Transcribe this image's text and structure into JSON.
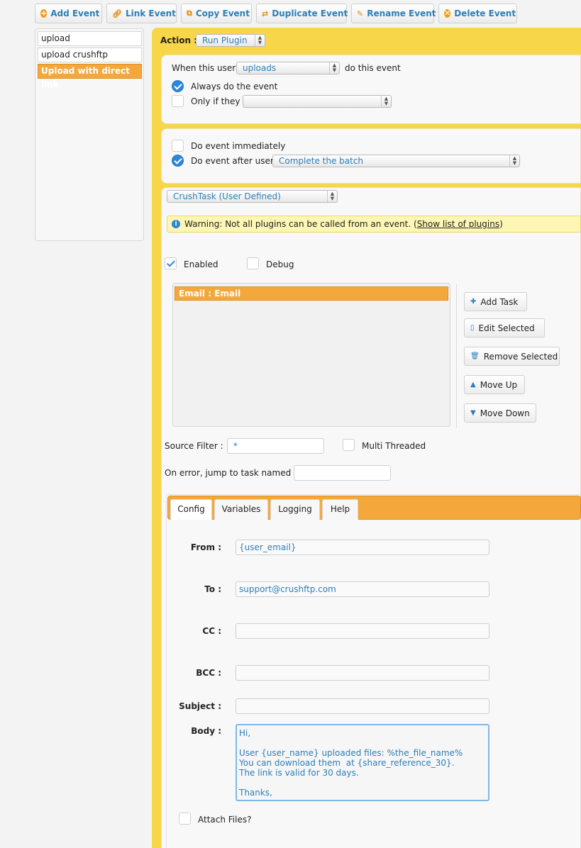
{
  "toolbar": {
    "add_event": "Add Event",
    "link_event": "Link Event",
    "copy_event": "Copy Event",
    "duplicate_event": "Duplicate Event",
    "rename_event": "Rename Event",
    "delete_event": "Delete Event"
  },
  "events": [
    {
      "label": "upload",
      "selected": false
    },
    {
      "label": "upload crushftp",
      "selected": false
    },
    {
      "label": "Upload with direct link",
      "selected": true
    }
  ],
  "action": {
    "label": "Action :",
    "value": "Run Plugin"
  },
  "trigger": {
    "when_label": "When this user",
    "user_select": "uploads",
    "do_label": "do this event",
    "always_label": "Always do the event",
    "always_checked": true,
    "only_if_label": "Only if they",
    "only_if_select": "",
    "only_if_checked": false
  },
  "timing": {
    "immediately_label": "Do event immediately",
    "immediately_checked": false,
    "after_label": "Do event after user",
    "after_checked": true,
    "after_select": "Complete the batch"
  },
  "plugin": {
    "select": "CrushTask (User Defined)",
    "warning_prefix": "Warning:",
    "warning_text": " Not all plugins can be called from an event. (",
    "warning_link": "Show list of plugins",
    "warning_suffix": ")",
    "enabled_label": "Enabled",
    "enabled_checked": true,
    "debug_label": "Debug",
    "debug_checked": false
  },
  "tasks": {
    "items": [
      "Email : Email"
    ],
    "add_task": "Add Task",
    "edit_selected": "Edit Selected",
    "remove_selected": "Remove Selected",
    "move_up": "Move Up",
    "move_down": "Move Down"
  },
  "options": {
    "source_filter_label": "Source Filter :",
    "source_filter_value": " *",
    "multi_threaded_label": "Multi Threaded",
    "on_error_label": "On error, jump to task named :",
    "on_error_value": ""
  },
  "tabs": [
    "Config",
    "Variables",
    "Logging",
    "Help"
  ],
  "email": {
    "from_label": "From :",
    "from_value": "{user_email}",
    "to_label": "To :",
    "to_value": "support@crushftp.com",
    "cc_label": "CC :",
    "cc_value": "",
    "bcc_label": "BCC :",
    "bcc_value": "",
    "subject_label": "Subject :",
    "subject_value": "",
    "body_label": "Body :",
    "body_value": "Hi,\n\nUser {user_name} uploaded files: %the_file_name%\nYou can download them  at {share_reference_30}.\nThe link is valid for 30 days.\n\nThanks,",
    "attach_label": "Attach Files?",
    "attach_checked": false
  }
}
